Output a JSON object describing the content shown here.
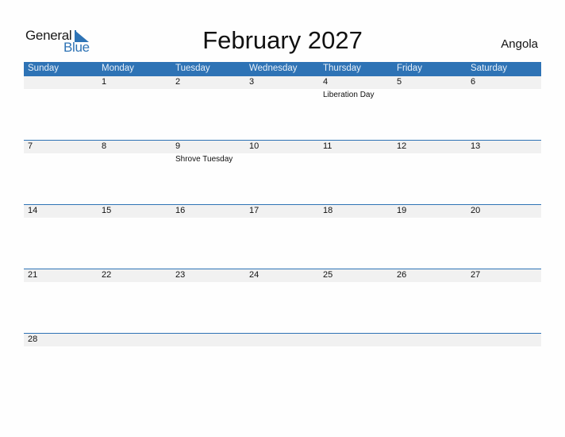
{
  "logo": {
    "line1": "General",
    "line2": "Blue"
  },
  "title": "February 2027",
  "country": "Angola",
  "colors": {
    "accent": "#2e73b5",
    "strip": "#f1f1f1"
  },
  "weekdays": [
    "Sunday",
    "Monday",
    "Tuesday",
    "Wednesday",
    "Thursday",
    "Friday",
    "Saturday"
  ],
  "weeks": [
    {
      "days": [
        "",
        "1",
        "2",
        "3",
        "4",
        "5",
        "6"
      ],
      "events": [
        "",
        "",
        "",
        "",
        "Liberation Day",
        "",
        ""
      ]
    },
    {
      "days": [
        "7",
        "8",
        "9",
        "10",
        "11",
        "12",
        "13"
      ],
      "events": [
        "",
        "",
        "Shrove Tuesday",
        "",
        "",
        "",
        ""
      ]
    },
    {
      "days": [
        "14",
        "15",
        "16",
        "17",
        "18",
        "19",
        "20"
      ],
      "events": [
        "",
        "",
        "",
        "",
        "",
        "",
        ""
      ]
    },
    {
      "days": [
        "21",
        "22",
        "23",
        "24",
        "25",
        "26",
        "27"
      ],
      "events": [
        "",
        "",
        "",
        "",
        "",
        "",
        ""
      ]
    },
    {
      "days": [
        "28",
        "",
        "",
        "",
        "",
        "",
        ""
      ],
      "events": [
        "",
        "",
        "",
        "",
        "",
        "",
        ""
      ]
    }
  ]
}
